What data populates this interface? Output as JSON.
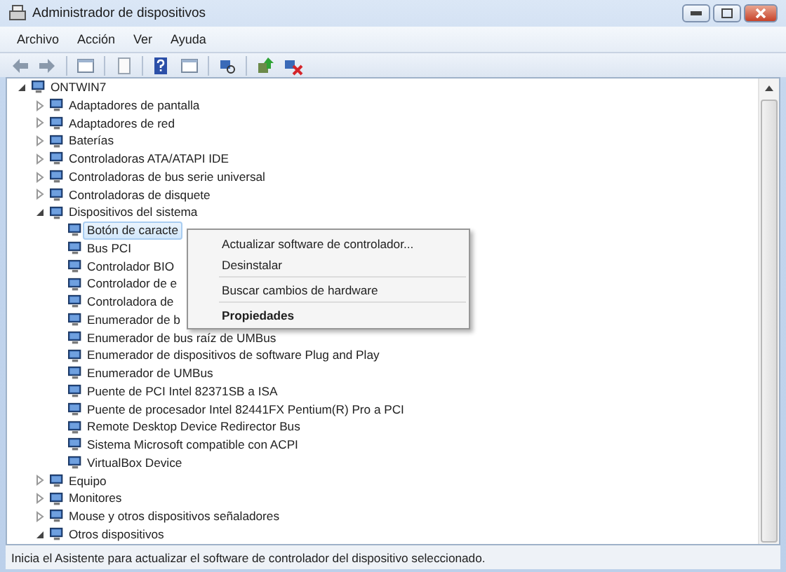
{
  "window": {
    "title": "Administrador de dispositivos"
  },
  "menu": [
    "Archivo",
    "Acción",
    "Ver",
    "Ayuda"
  ],
  "tree": {
    "label": "ONTWIN7",
    "expanded": true,
    "selected": false,
    "children": [
      {
        "label": "Adaptadores de pantalla",
        "expanded": false,
        "selected": false
      },
      {
        "label": "Adaptadores de red",
        "expanded": false,
        "selected": false
      },
      {
        "label": "Baterías",
        "expanded": false,
        "selected": false
      },
      {
        "label": "Controladoras ATA/ATAPI IDE",
        "expanded": false,
        "selected": false
      },
      {
        "label": "Controladoras de bus serie universal",
        "expanded": false,
        "selected": false
      },
      {
        "label": "Controladoras de disquete",
        "expanded": false,
        "selected": false
      },
      {
        "label": "Dispositivos del sistema",
        "expanded": true,
        "selected": false,
        "children": [
          {
            "label": "Botón de caracte",
            "selected": true
          },
          {
            "label": "Bus PCI",
            "selected": false
          },
          {
            "label": "Controlador BIO",
            "selected": false
          },
          {
            "label": "Controlador de e",
            "selected": false
          },
          {
            "label": "Controladora de",
            "selected": false
          },
          {
            "label": "Enumerador de b",
            "selected": false
          },
          {
            "label": "Enumerador de bus raíz de UMBus",
            "selected": false
          },
          {
            "label": "Enumerador de dispositivos de software Plug and Play",
            "selected": false
          },
          {
            "label": "Enumerador de UMBus",
            "selected": false
          },
          {
            "label": "Puente de PCI Intel 82371SB a ISA",
            "selected": false
          },
          {
            "label": "Puente de procesador Intel 82441FX Pentium(R) Pro a PCI",
            "selected": false
          },
          {
            "label": "Remote Desktop Device Redirector Bus",
            "selected": false
          },
          {
            "label": "Sistema Microsoft compatible con ACPI",
            "selected": false
          },
          {
            "label": "VirtualBox Device",
            "selected": false
          }
        ]
      },
      {
        "label": "Equipo",
        "expanded": false,
        "selected": false
      },
      {
        "label": "Monitores",
        "expanded": false,
        "selected": false
      },
      {
        "label": "Mouse y otros dispositivos señaladores",
        "expanded": false,
        "selected": false
      },
      {
        "label": "Otros dispositivos",
        "expanded": true,
        "selected": false
      }
    ]
  },
  "context_menu": {
    "items": [
      {
        "kind": "item",
        "label": "Actualizar software de controlador..."
      },
      {
        "kind": "item",
        "label": "Desinstalar"
      },
      {
        "kind": "separator"
      },
      {
        "kind": "item",
        "label": "Buscar cambios de hardware"
      },
      {
        "kind": "separator"
      },
      {
        "kind": "default",
        "label": "Propiedades"
      }
    ]
  },
  "status_bar": "Inicia el Asistente para actualizar el software de controlador del dispositivo seleccionado."
}
